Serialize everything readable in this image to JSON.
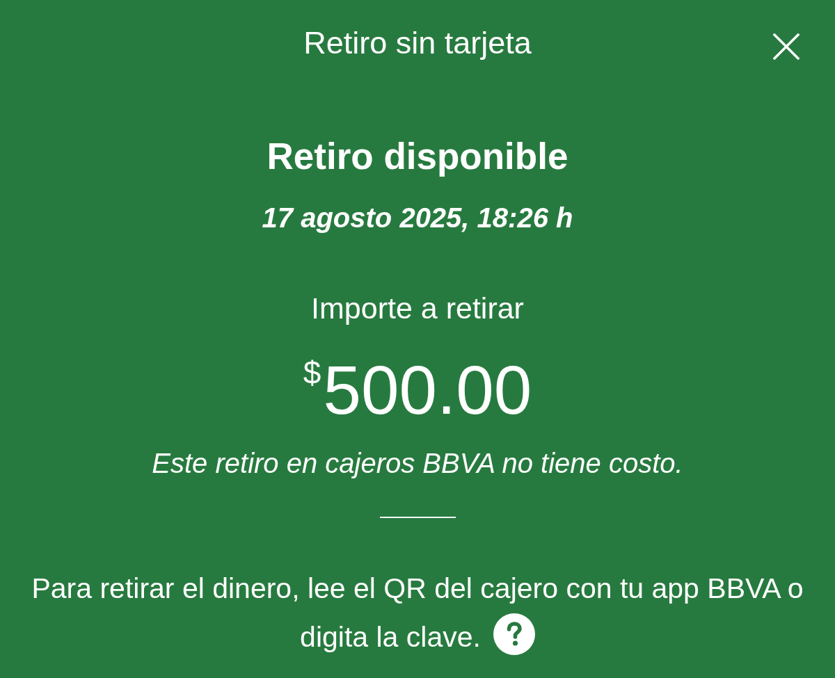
{
  "header": {
    "title": "Retiro sin tarjeta",
    "close_button": true
  },
  "status": {
    "heading": "Retiro disponible",
    "date": "17 agosto 2025, 18:26 h"
  },
  "amount": {
    "label": "Importe a retirar",
    "currency": "$",
    "value": "500.00",
    "note": "Este retiro en cajeros BBVA no tiene costo."
  },
  "instructions": {
    "lines": [
      "Para retirar el dinero, lee el QR del cajero con tu app BBVA o",
      "digita la clave."
    ],
    "help_button": true
  }
}
